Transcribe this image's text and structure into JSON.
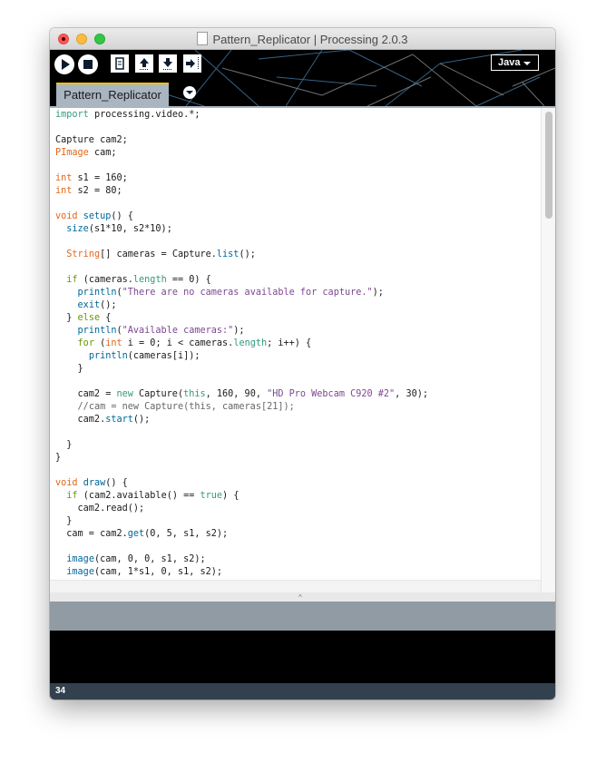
{
  "window": {
    "title": "Pattern_Replicator | Processing 2.0.3"
  },
  "toolbar": {
    "run_icon": "play-icon",
    "stop_icon": "stop-icon",
    "new_icon": "new-sketch-icon",
    "open_icon": "open-upload-arrow-icon",
    "save_icon": "save-download-arrow-icon",
    "export_icon": "export-arrow-icon",
    "mode_label": "Java"
  },
  "tabs": [
    {
      "label": "Pattern_Replicator",
      "active": true
    }
  ],
  "editor": {
    "lines": [
      "import processing.video.*;",
      "",
      "Capture cam2;",
      "PImage cam;",
      "",
      "int s1 = 160;",
      "int s2 = 80;",
      "",
      "void setup() {",
      "  size(s1*10, s2*10);",
      "",
      "  String[] cameras = Capture.list();",
      "",
      "  if (cameras.length == 0) {",
      "    println(\"There are no cameras available for capture.\");",
      "    exit();",
      "  } else {",
      "    println(\"Available cameras:\");",
      "    for (int i = 0; i < cameras.length; i++) {",
      "      println(cameras[i]);",
      "    }",
      "",
      "    cam2 = new Capture(this, 160, 90, \"HD Pro Webcam C920 #2\", 30);",
      "    //cam = new Capture(this, cameras[21]);",
      "    cam2.start();",
      "",
      "  }",
      "}",
      "",
      "void draw() {",
      "  if (cam2.available() == true) {",
      "    cam2.read();",
      "  }",
      "  cam = cam2.get(0, 5, s1, s2);",
      "",
      "  image(cam, 0, 0, s1, s2);",
      "  image(cam, 1*s1, 0, s1, s2);"
    ]
  },
  "message_area": "",
  "console": "",
  "status": {
    "line_number": "34"
  },
  "colors": {
    "toolbar_bg": "#000000",
    "tab_bg": "#a9b5c0",
    "tab_accent": "#f2c200",
    "message_bg": "#909ba3",
    "console_bg": "#000000",
    "status_bg": "#33414e",
    "syntax_keyword_import": "#33997e",
    "syntax_type": "#e2661a",
    "syntax_control": "#669900",
    "syntax_function": "#006699",
    "syntax_string": "#7d4793",
    "syntax_comment": "#666666"
  }
}
